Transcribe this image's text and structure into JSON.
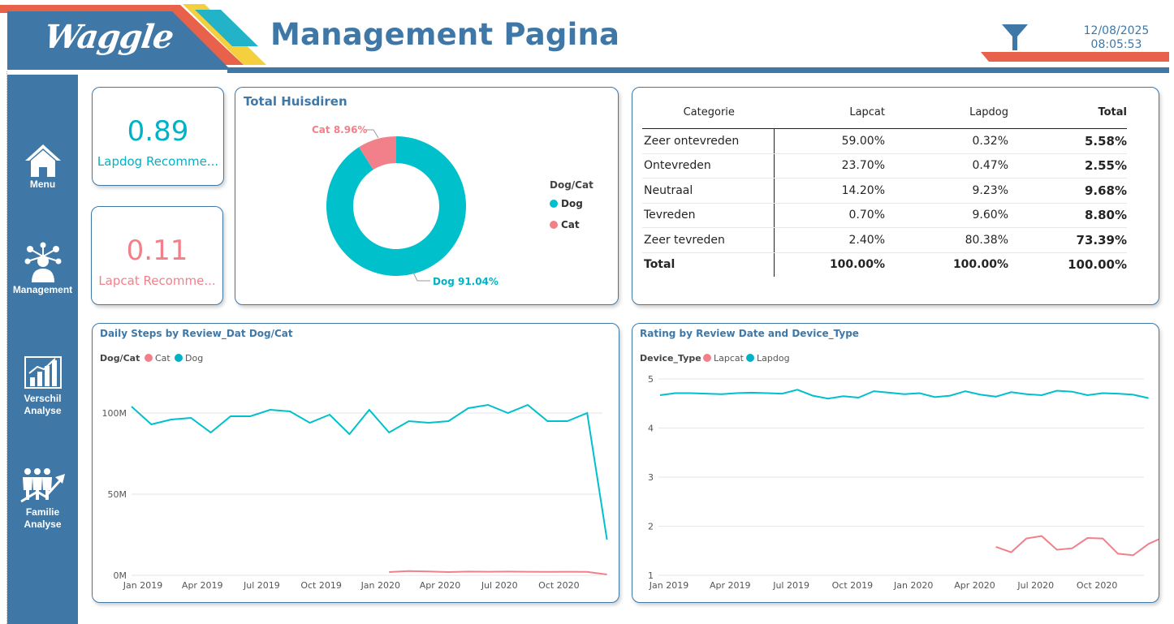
{
  "header": {
    "logo_text": "Waggle",
    "title": "Management Pagina",
    "date": "12/08/2025",
    "time": "08:05:53",
    "filter_icon": "filter-icon"
  },
  "colors": {
    "primary": "#3f78a6",
    "dog": "#00c0cc",
    "cat": "#f2808a",
    "accent_orange": "#e8614a",
    "accent_yellow": "#f4d03f",
    "accent_teal": "#22b3c9"
  },
  "sidebar": {
    "items": [
      {
        "label": "Menu",
        "icon": "home-icon"
      },
      {
        "label": "Management",
        "icon": "team-network-icon"
      },
      {
        "label": "Verschil Analyse",
        "icon": "bar-chart-growth-icon"
      },
      {
        "label": "Familie Analyse",
        "icon": "family-growth-icon"
      }
    ]
  },
  "kpis": [
    {
      "value": "0.89",
      "label": "Lapdog Recomme...",
      "color": "#00b3c4"
    },
    {
      "value": "0.11",
      "label": "Lapcat Recomme...",
      "color": "#f2808a"
    }
  ],
  "donut": {
    "title": "Total Huisdiren",
    "legend_title": "Dog/Cat",
    "legend": [
      "Dog",
      "Cat"
    ],
    "label_cat": "Cat 8.96%",
    "label_dog": "Dog 91.04%"
  },
  "matrix": {
    "headers": [
      "Categorie",
      "Lapcat",
      "Lapdog",
      "Total"
    ],
    "rows": [
      [
        "Zeer ontevreden",
        "59.00%",
        "0.32%",
        "5.58%"
      ],
      [
        "Ontevreden",
        "23.70%",
        "0.47%",
        "2.55%"
      ],
      [
        "Neutraal",
        "14.20%",
        "9.23%",
        "9.68%"
      ],
      [
        "Tevreden",
        "0.70%",
        "9.60%",
        "8.80%"
      ],
      [
        "Zeer tevreden",
        "2.40%",
        "80.38%",
        "73.39%"
      ]
    ],
    "total_row": [
      "Total",
      "100.00%",
      "100.00%",
      "100.00%"
    ]
  },
  "line1": {
    "title": "Daily Steps by Review_Dat Dog/Cat",
    "legend_title": "Dog/Cat",
    "legend": [
      "Cat",
      "Dog"
    ]
  },
  "line2": {
    "title": "Rating by Review Date and Device_Type",
    "legend_title": "Device_Type",
    "legend": [
      "Lapcat",
      "Lapdog"
    ]
  },
  "chart_data": [
    {
      "type": "pie",
      "title": "Total Huisdiren",
      "legend_title": "Dog/Cat",
      "categories": [
        "Dog",
        "Cat"
      ],
      "values": [
        91.04,
        8.96
      ]
    },
    {
      "type": "table",
      "columns": [
        "Categorie",
        "Lapcat",
        "Lapdog",
        "Total"
      ],
      "rows": [
        [
          "Zeer ontevreden",
          59.0,
          0.32,
          5.58
        ],
        [
          "Ontevreden",
          23.7,
          0.47,
          2.55
        ],
        [
          "Neutraal",
          14.2,
          9.23,
          9.68
        ],
        [
          "Tevreden",
          0.7,
          9.6,
          8.8
        ],
        [
          "Zeer tevreden",
          2.4,
          80.38,
          73.39
        ],
        [
          "Total",
          100.0,
          100.0,
          100.0
        ]
      ]
    },
    {
      "type": "line",
      "title": "Daily Steps by Review_Dat Dog/Cat",
      "legend_title": "Dog/Cat",
      "ylim": [
        0,
        110000000
      ],
      "yticks": [
        "0M",
        "50M",
        "100M"
      ],
      "xticks": [
        "Jan 2019",
        "Apr 2019",
        "Jul 2019",
        "Oct 2019",
        "Jan 2020",
        "Apr 2020",
        "Jul 2020",
        "Oct 2020"
      ],
      "series": [
        {
          "name": "Dog",
          "x": [
            "2019-01",
            "2019-02",
            "2019-03",
            "2019-04",
            "2019-05",
            "2019-06",
            "2019-07",
            "2019-08",
            "2019-09",
            "2019-10",
            "2019-11",
            "2019-12",
            "2020-01",
            "2020-02",
            "2020-03",
            "2020-04",
            "2020-05",
            "2020-06",
            "2020-07",
            "2020-08",
            "2020-09",
            "2020-10",
            "2020-11",
            "2020-12",
            "2021-01"
          ],
          "values": [
            104,
            93,
            96,
            97,
            88,
            98,
            98,
            102,
            101,
            94,
            99,
            87,
            102,
            88,
            95,
            94,
            95,
            103,
            105,
            100,
            105,
            95,
            95,
            100,
            22
          ]
        },
        {
          "name": "Cat",
          "x": [
            "2020-02",
            "2020-03",
            "2020-04",
            "2020-05",
            "2020-06",
            "2020-07",
            "2020-08",
            "2020-09",
            "2020-10",
            "2020-11",
            "2020-12",
            "2021-01"
          ],
          "values": [
            2,
            2.6,
            2.4,
            2,
            2.3,
            2.2,
            2.3,
            2.2,
            2.1,
            2.2,
            2.1,
            0.5
          ],
          "unit": "M"
        }
      ]
    },
    {
      "type": "line",
      "title": "Rating by Review Date and Device_Type",
      "legend_title": "Device_Type",
      "ylim": [
        1,
        5
      ],
      "yticks": [
        1,
        2,
        3,
        4,
        5
      ],
      "xticks": [
        "Jan 2019",
        "Apr 2019",
        "Jul 2019",
        "Oct 2019",
        "Jan 2020",
        "Apr 2020",
        "Jul 2020",
        "Oct 2020"
      ],
      "series": [
        {
          "name": "Lapdog",
          "values": [
            4.67,
            4.71,
            4.71,
            4.7,
            4.69,
            4.71,
            4.72,
            4.71,
            4.7,
            4.78,
            4.66,
            4.6,
            4.65,
            4.62,
            4.75,
            4.72,
            4.69,
            4.71,
            4.63,
            4.66,
            4.75,
            4.68,
            4.64,
            4.73,
            4.69,
            4.67,
            4.76,
            4.74,
            4.67,
            4.71,
            4.7,
            4.68,
            4.61
          ]
        },
        {
          "name": "Lapcat",
          "x_start_index": 22,
          "values": [
            1.58,
            1.47,
            1.75,
            1.8,
            1.52,
            1.55,
            1.76,
            1.75,
            1.44,
            1.41,
            1.64,
            1.78,
            1.8,
            1.58
          ]
        }
      ]
    }
  ]
}
